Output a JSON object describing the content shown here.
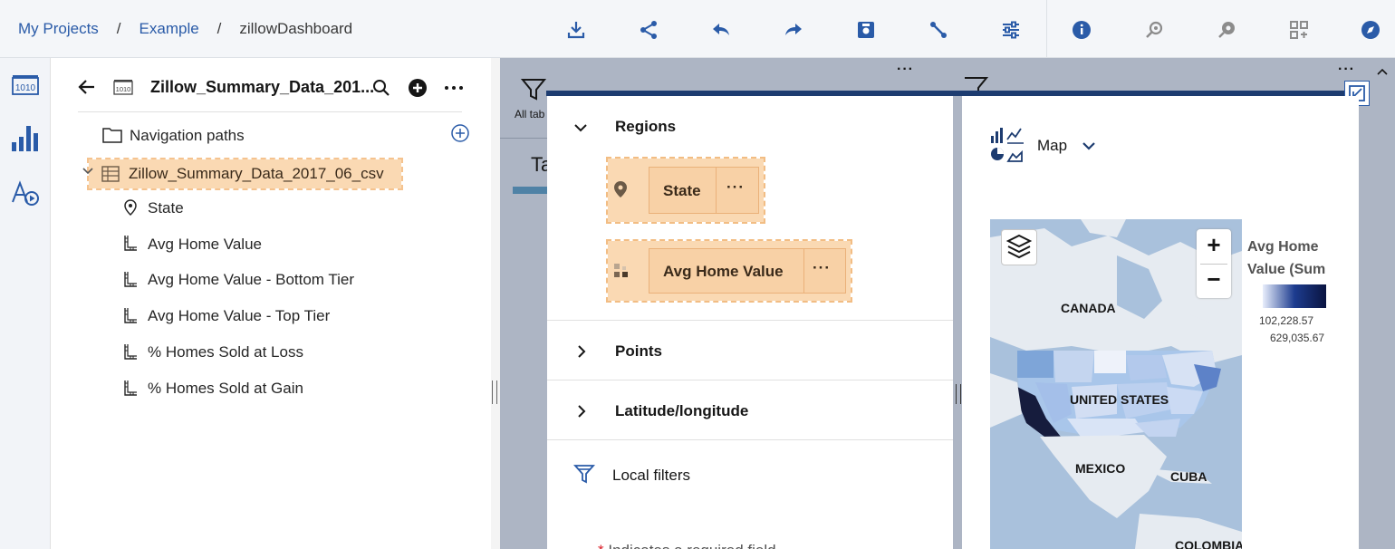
{
  "breadcrumb": {
    "items": [
      "My Projects",
      "Example",
      "zillowDashboard"
    ],
    "separator": "/"
  },
  "toolbar": {
    "icons": [
      "download-icon",
      "share-icon",
      "undo-icon",
      "redo-icon",
      "snapshot-icon",
      "connect-icon",
      "filter-settings-icon",
      "info-icon",
      "explore-icon",
      "assistant-icon",
      "layout-icon",
      "navigate-icon"
    ]
  },
  "data_panel": {
    "title": "Zillow_Summary_Data_201...",
    "navigation_paths": "Navigation paths",
    "source": "Zillow_Summary_Data_2017_06_csv",
    "fields": [
      "State",
      "Avg Home Value",
      "Avg Home Value - Bottom Tier",
      "Avg Home Value - Top Tier",
      "% Homes Sold at Loss",
      "% Homes Sold at Gain"
    ]
  },
  "canvas": {
    "tab_label_partial": "All tab",
    "tab_title_partial": "Ta",
    "more": "···"
  },
  "properties": {
    "regions": {
      "label": "Regions",
      "slots": [
        {
          "field": "State",
          "more": "···"
        },
        {
          "field": "Avg Home Value",
          "more": "···"
        }
      ]
    },
    "points": "Points",
    "latlong": "Latitude/longitude",
    "local_filters": "Local filters",
    "required_note": "Indicates a required field"
  },
  "viz": {
    "type_label": "Map",
    "map_labels": [
      "CANADA",
      "UNITED STATES",
      "MEXICO",
      "CUBA",
      "COLOMBIA"
    ],
    "legend_title_1": "Avg Home",
    "legend_title_2": "Value (Sum",
    "legend_min": "102,228.57",
    "legend_max": "629,035.67",
    "zoom_in": "+",
    "zoom_out": "−"
  },
  "colors": {
    "accent": "#2a5ba8",
    "dark_blue": "#1d3c70",
    "highlight": "#fad9b3"
  }
}
